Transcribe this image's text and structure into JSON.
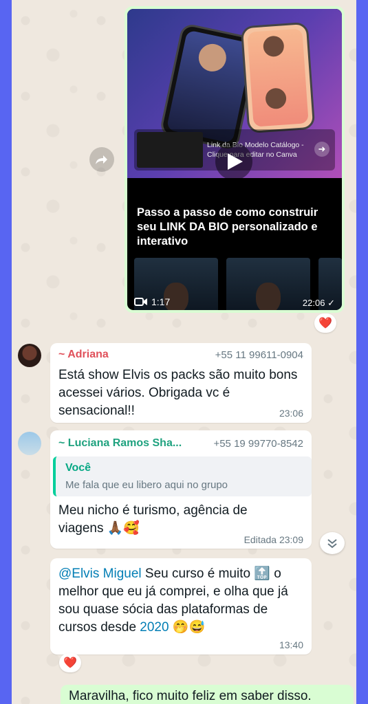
{
  "video": {
    "link_title": "Link da Bio Modelo Catálogo - Clique para editar no Canva",
    "title": "Passo a passo de como construir seu LINK DA BIO personalizado e interativo",
    "duration": "1:17",
    "time": "22:06",
    "reaction": "❤️"
  },
  "messages": [
    {
      "sender": "~ Adriana",
      "sender_color": "#e0505a",
      "phone": "+55 11 99611-0904",
      "text": "Está show Elvis os packs são muito bons acessei vários. Obrigada vc é sensacional!!",
      "time": "23:06"
    },
    {
      "sender": "~ Luciana Ramos Sha...",
      "sender_color": "#1fa27f",
      "phone": "+55 19 99770-8542",
      "quote_author": "Você",
      "quote_text": "Me fala que eu libero aqui no grupo",
      "text": "Meu nicho é turismo, agência de viagens 🙏🏾🥰",
      "time": "Editada 23:09"
    },
    {
      "mention": "@Elvis Miguel",
      "text_a": " Seu curso é muito 🔝 o melhor que eu já comprei, e olha que já sou quase sócia das plataformas de cursos desde ",
      "highlight": "2020",
      "text_b": " 🤭😅",
      "time": "13:40",
      "reaction": "❤️"
    }
  ],
  "outgoing": {
    "text": "Maravilha, fico muito feliz em saber disso."
  }
}
